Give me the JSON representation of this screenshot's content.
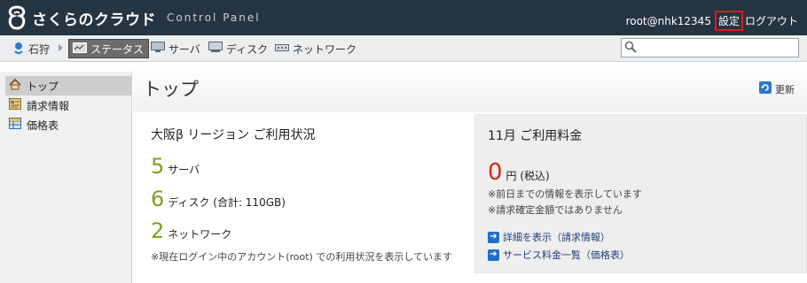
{
  "header": {
    "logo_text": "さくらのクラウド",
    "logo_subtitle": "Control Panel",
    "user": "root@nhk12345",
    "settings_label": "設定",
    "logout_label": "ログアウト"
  },
  "nav": {
    "zone": "石狩",
    "items": [
      {
        "label": "ステータス",
        "icon": "status-icon",
        "active": true
      },
      {
        "label": "サーバ",
        "icon": "server-icon",
        "active": false
      },
      {
        "label": "ディスク",
        "icon": "disk-icon",
        "active": false
      },
      {
        "label": "ネットワーク",
        "icon": "network-icon",
        "active": false
      }
    ],
    "search_value": ""
  },
  "sidebar": {
    "items": [
      {
        "label": "トップ",
        "icon": "home-icon",
        "active": true
      },
      {
        "label": "請求情報",
        "icon": "invoice-icon",
        "active": false
      },
      {
        "label": "価格表",
        "icon": "price-table-icon",
        "active": false
      }
    ]
  },
  "main": {
    "title": "トップ",
    "refresh_label": "更新",
    "usage": {
      "title": "大阪β リージョン ご利用状況",
      "servers_count": "5",
      "servers_label": "サーバ",
      "disks_count": "6",
      "disks_label": "ディスク (合計: 110GB)",
      "networks_count": "2",
      "networks_label": "ネットワーク",
      "note": "※現在ログイン中のアカウント(root) での利用状況を表示しています"
    },
    "billing": {
      "title": "11月 ご利用料金",
      "amount": "0",
      "amount_unit": "円 (税込)",
      "note1": "※前日までの情報を表示しています",
      "note2": "※請求確定金額ではありません",
      "link1": "詳細を表示（請求情報）",
      "link2": "サービス料金一覧（価格表）"
    }
  },
  "colors": {
    "header_bg": "#243441",
    "count_green": "#7aa21b",
    "amount_red": "#d52a1a",
    "link_blue": "#1f3f7a",
    "highlight_border": "#e0161b"
  }
}
